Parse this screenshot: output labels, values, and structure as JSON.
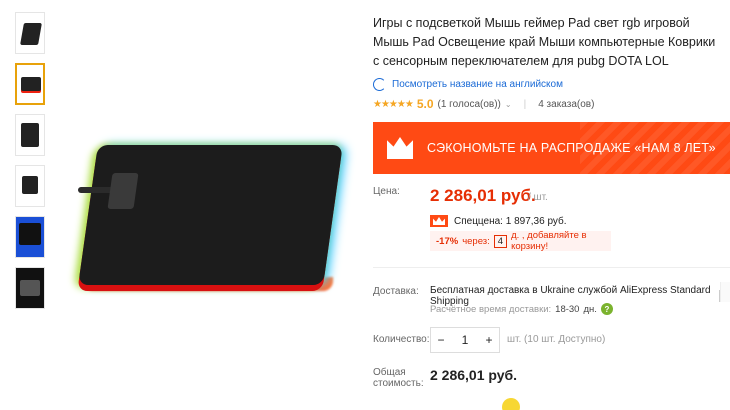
{
  "product": {
    "title": "Игры с подсветкой Мышь геймер Pad свет rgb игровой Мышь Pad Освещение край Мыши компьютерные Коврики с сенсорным переключателем для pubg DOTA LOL",
    "translate_link": "Посмотреть название на английском",
    "rating_value": "5.0",
    "votes": "(1 голоса(ов))",
    "orders": "4 заказа(ов)"
  },
  "banner": {
    "text": "СЭКОНОМЬТЕ НА РАСПРОДАЖЕ «НАМ 8 ЛЕТ»",
    "color": "#ff4a14"
  },
  "price": {
    "label": "Цена:",
    "amount": "2 286,01 руб.",
    "unit": "/ шт.",
    "special": "Спеццена: 1 897,36 руб.",
    "discount_pct": "-17%",
    "discount_prefix": "через:",
    "discount_days": "4",
    "discount_suffix": "д. , добавляйте в корзину!"
  },
  "delivery": {
    "label": "Доставка:",
    "text": "Бесплатная доставка в Ukraine службой AliExpress Standard Shipping",
    "time_label": "Расчётное время доставки:",
    "time_value": "18-30",
    "time_unit": "дн."
  },
  "quantity": {
    "label": "Количество:",
    "minus": "−",
    "value": "1",
    "plus": "+",
    "note": "шт. (10 шт. Доступно)"
  },
  "total": {
    "label_1": "Общая",
    "label_2": "стоимость:",
    "value": "2 286,01 руб."
  },
  "icons": {
    "stars": "★★★★★",
    "chevron": "⌄",
    "question": "?"
  },
  "colors": {
    "accent": "#ff4a14",
    "price": "#e62e04",
    "link": "#1a6ad6",
    "star": "#f5a623"
  }
}
